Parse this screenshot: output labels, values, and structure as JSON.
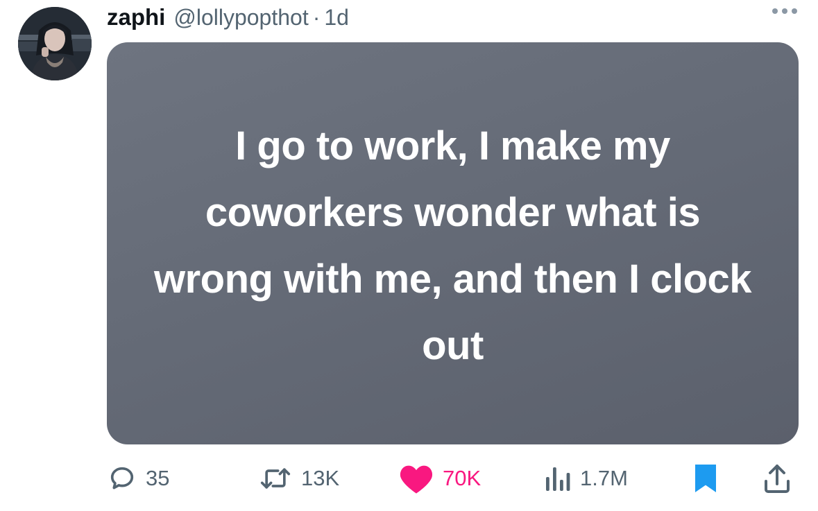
{
  "tweet": {
    "display_name": "zaphi",
    "handle": "@lollypopthot",
    "separator": "·",
    "time": "1d",
    "image_text": "I go to work, I make my coworkers wonder what is wrong with me, and then I clock out"
  },
  "actions": {
    "replies": "35",
    "retweets": "13K",
    "likes": "70K",
    "views": "1.7M"
  },
  "icons": {
    "reply": "speech-bubble-icon",
    "retweet": "retweet-arrows-icon",
    "like": "heart-icon",
    "views": "bar-chart-icon",
    "bookmark": "bookmark-icon",
    "share": "share-upload-icon",
    "more": "more-dots-icon"
  },
  "colors": {
    "like": "#f91880",
    "bookmark": "#1d9bf0",
    "secondary_text": "#536471",
    "media_bg": "#656b77"
  }
}
